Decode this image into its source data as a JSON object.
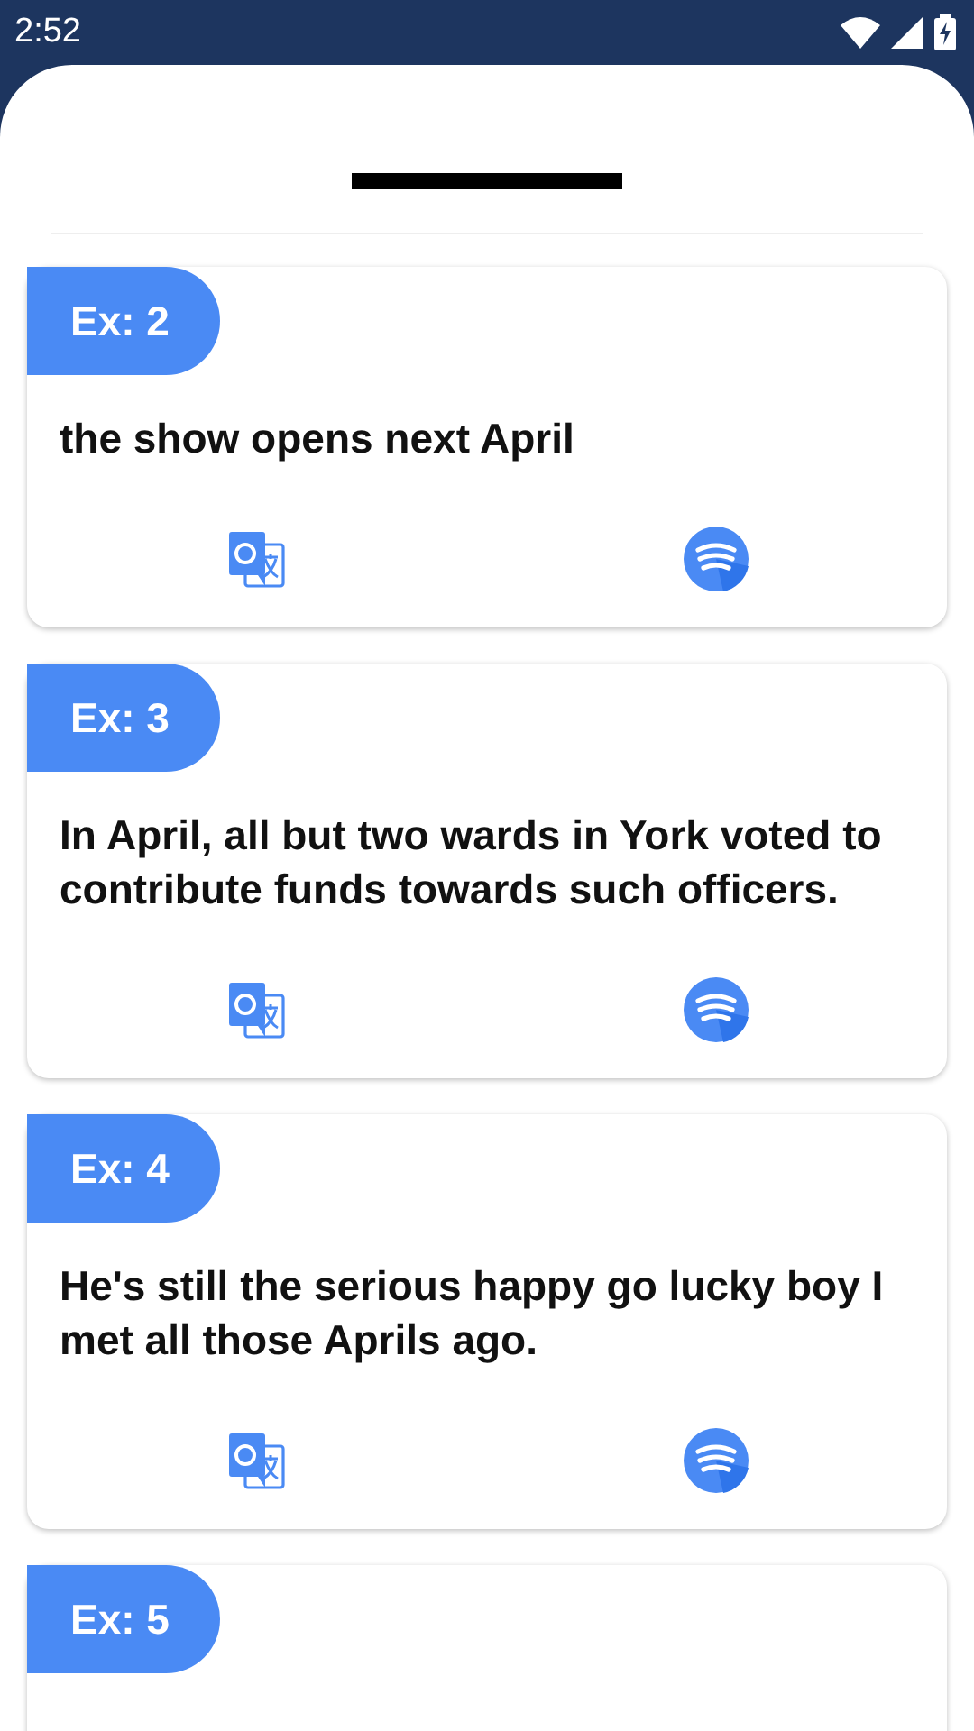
{
  "status_bar": {
    "time": "2:52"
  },
  "examples": [
    {
      "label": "Ex: 2",
      "text": "the show opens next April"
    },
    {
      "label": "Ex: 3",
      "text": "In April, all but two wards in York voted to contribute funds towards such officers."
    },
    {
      "label": "Ex: 4",
      "text": "He's still the serious happy go lucky boy I met all those Aprils ago."
    },
    {
      "label": "Ex: 5"
    }
  ]
}
